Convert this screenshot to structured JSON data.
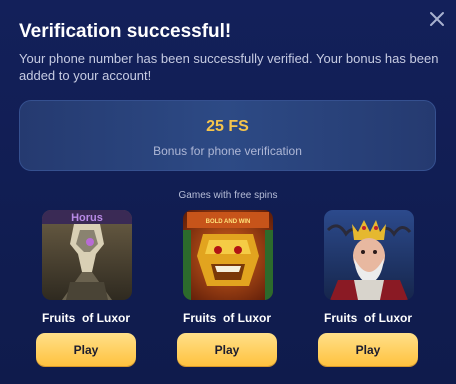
{
  "modal": {
    "title": "Verification successful!",
    "description": "Your phone number has been successfully verified. Your bonus has been added to your account!",
    "close_icon": "close-icon"
  },
  "bonus": {
    "amount": "25 FS",
    "label": "Bonus for phone verification"
  },
  "games_section": {
    "title": "Games with free spins"
  },
  "games": [
    {
      "name": "Fruits  of Luxor",
      "play_label": "Play",
      "thumb_text": "Horus"
    },
    {
      "name": "Fruits  of Luxor",
      "play_label": "Play",
      "thumb_text": "BOLD AND WIN"
    },
    {
      "name": "Fruits  of Luxor",
      "play_label": "Play"
    }
  ],
  "colors": {
    "background": "#13205a",
    "accent_gold": "#f6c54c",
    "button": "#ffc23f"
  }
}
